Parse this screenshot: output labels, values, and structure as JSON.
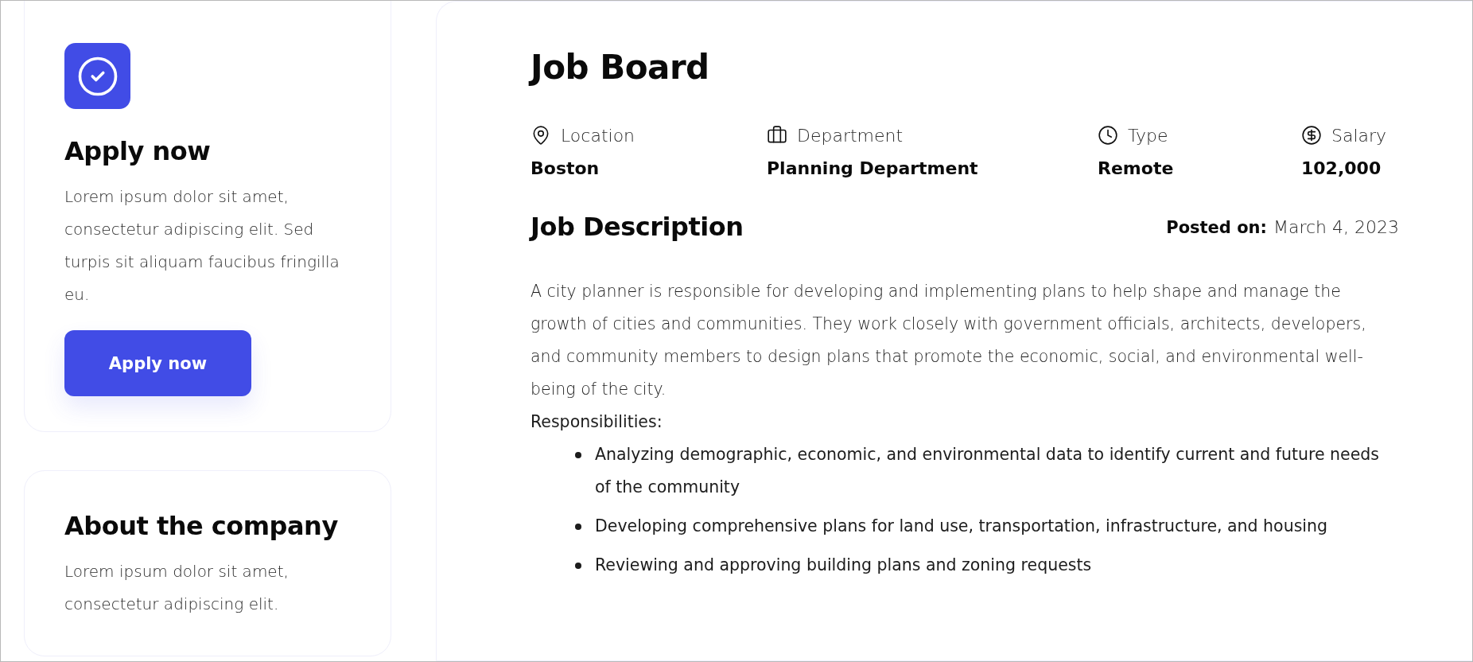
{
  "sidebar": {
    "apply_card": {
      "title": "Apply now",
      "text": "Lorem ipsum dolor sit amet, consectetur adipiscing elit. Sed turpis sit aliquam faucibus fringilla eu.",
      "button": "Apply now"
    },
    "about_card": {
      "title": "About the company",
      "text": "Lorem ipsum dolor sit amet, consectetur adipiscing elit."
    }
  },
  "job": {
    "title": "Job Board",
    "details": [
      {
        "kind": "location",
        "label": "Location",
        "value": "Boston"
      },
      {
        "kind": "department",
        "label": "Department",
        "value": "Planning Department"
      },
      {
        "kind": "type",
        "label": "Type",
        "value": "Remote"
      },
      {
        "kind": "salary",
        "label": "Salary",
        "value": "102,000"
      }
    ],
    "description": {
      "title": "Job Description",
      "posted_label": "Posted on:",
      "posted_date": "March 4, 2023",
      "paragraph": "A city planner is responsible for developing and implementing plans to help shape and manage the growth of cities and communities. They work closely with government officials, architects, developers, and community members to design plans that promote the economic, social, and environmental well-being of the city.",
      "responsibilities_label": "Responsibilities:",
      "responsibilities": [
        "Analyzing demographic, economic, and environmental data to identify current and future needs of the community",
        "Developing comprehensive plans for land use, transportation, infrastructure, and housing",
        "Reviewing and approving building plans and zoning requests"
      ]
    }
  }
}
